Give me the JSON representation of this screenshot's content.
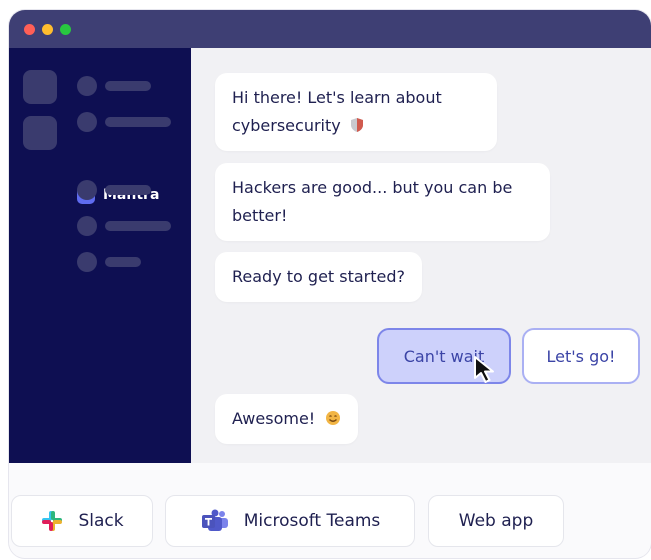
{
  "sidebar": {
    "active_item": "Mantra"
  },
  "chat": {
    "messages": [
      "Hi there! Let's learn about cybersecurity",
      "Hackers are good... but you can be better!",
      "Ready to get started?"
    ],
    "replies": [
      "Can't wait",
      "Let's go!"
    ],
    "final_message": "Awesome!"
  },
  "platforms": [
    {
      "label": "Slack",
      "icon": "slack-icon"
    },
    {
      "label": "Microsoft Teams",
      "icon": "teams-icon"
    },
    {
      "label": "Web app",
      "icon": ""
    }
  ],
  "colors": {
    "sidebar": "#0e0f52",
    "titlebar": "#3e3f74",
    "reply_selected_bg": "#cdd1fb",
    "reply_border": "#7d86e9",
    "text": "#1f2050"
  }
}
